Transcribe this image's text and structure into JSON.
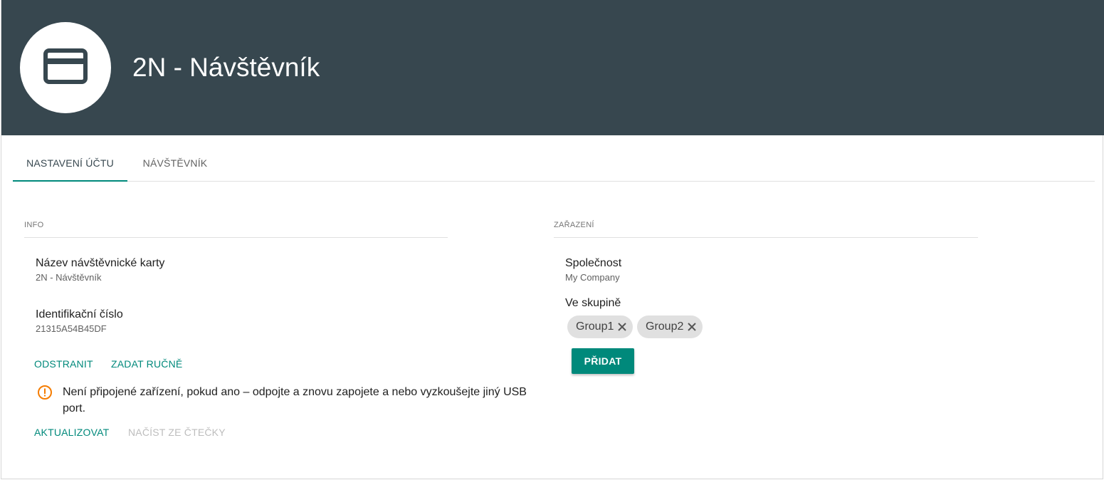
{
  "header": {
    "title": "2N - Návštěvník",
    "avatar_icon": "credit-card-icon",
    "background_color": "#37474f"
  },
  "tabs": [
    {
      "label": "NASTAVENÍ ÚČTU",
      "active": true
    },
    {
      "label": "NÁVŠTĚVNÍK",
      "active": false
    }
  ],
  "info": {
    "section_title": "INFO",
    "card_name_label": "Název návštěvnické karty",
    "card_name_value": "2N - Návštěvník",
    "id_label": "Identifikační číslo",
    "id_value": "21315A54B45DF",
    "remove_label": "ODSTRANIT",
    "manual_label": "ZADAT RUČNĚ",
    "warning_icon": "warning-circle-icon",
    "warning_text": "Není připojené zařízení, pokud ano – odpojte a znovu zapojete a nebo vyzkoušejte jiný USB port.",
    "refresh_label": "AKTUALIZOVAT",
    "read_label": "NAČÍST ZE ČTEČKY"
  },
  "assignment": {
    "section_title": "ZAŘAZENÍ",
    "company_label": "Společnost",
    "company_value": "My Company",
    "group_label": "Ve skupině",
    "groups": [
      "Group1",
      "Group2"
    ],
    "add_label": "PŘIDAT"
  },
  "colors": {
    "accent": "#00897b",
    "warning": "#f57c00"
  }
}
